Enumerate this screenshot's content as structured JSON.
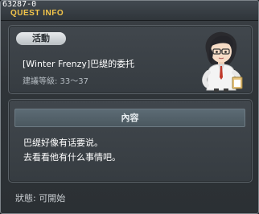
{
  "window": {
    "quest_id": "63287-0",
    "title": "QUEST INFO"
  },
  "quest": {
    "badge": "活動",
    "name": "[Winter Frenzy]巴缇的委托",
    "level_requirement": "建議等級: 33～37",
    "npc_icon": "npc-portrait-icon"
  },
  "content": {
    "header": "內容",
    "lines": [
      "巴缇好像有话要说。",
      "去看看他有什么事情吧。"
    ]
  },
  "status": {
    "text": "狀態: 可開始"
  },
  "colors": {
    "title_accent": "#f4c64a",
    "background": "#2f3438"
  }
}
